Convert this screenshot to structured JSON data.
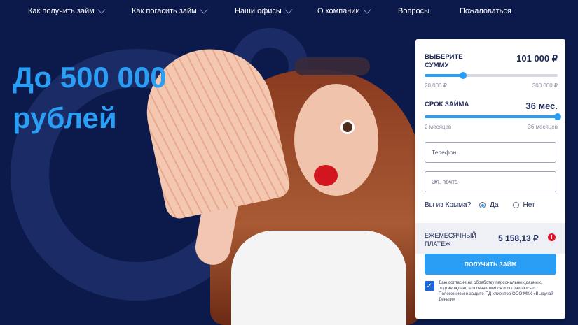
{
  "nav": {
    "items": [
      {
        "label": "Как получить займ",
        "dropdown": true
      },
      {
        "label": "Как погасить займ",
        "dropdown": true
      },
      {
        "label": "Наши офисы",
        "dropdown": true
      },
      {
        "label": "О компании",
        "dropdown": true
      },
      {
        "label": "Вопросы",
        "dropdown": false
      },
      {
        "label": "Пожаловаться",
        "dropdown": false
      }
    ]
  },
  "hero": {
    "line1": "До 500 000",
    "line2": "рублей"
  },
  "calculator": {
    "amount": {
      "label_line1": "ВЫБЕРИТЕ",
      "label_line2": "СУММУ",
      "value": "101 000 ₽",
      "min": "20 000 ₽",
      "max": "300 000 ₽",
      "fraction": 0.29
    },
    "term": {
      "label": "СРОК ЗАЙМА",
      "value": "36 мес.",
      "min": "2 месяцев",
      "max": "36 месяцев",
      "fraction": 1.0
    },
    "phone_placeholder": "Телефон",
    "email_placeholder": "Эл. почта",
    "crimea": {
      "question": "Вы из Крыма?",
      "yes": "Да",
      "no": "Нет",
      "selected": "yes"
    },
    "monthly": {
      "label_line1": "ЕЖЕМЕСЯЧНЫЙ",
      "label_line2": "ПЛАТЕЖ",
      "value": "5 158,13 ₽",
      "info": "!"
    },
    "submit_label": "ПОЛУЧИТЬ ЗАЙМ",
    "consent_checked": "✓",
    "consent_text": "Даю согласие на обработку персональных данных, подтверждаю, что ознакомился и соглашаюсь с Положением о защите ПД клиентов ООО МКК «Выручай-Деньги»"
  },
  "colors": {
    "background": "#0b1a4a",
    "accent": "#2a9df4",
    "text_dark": "#1d2a57"
  }
}
